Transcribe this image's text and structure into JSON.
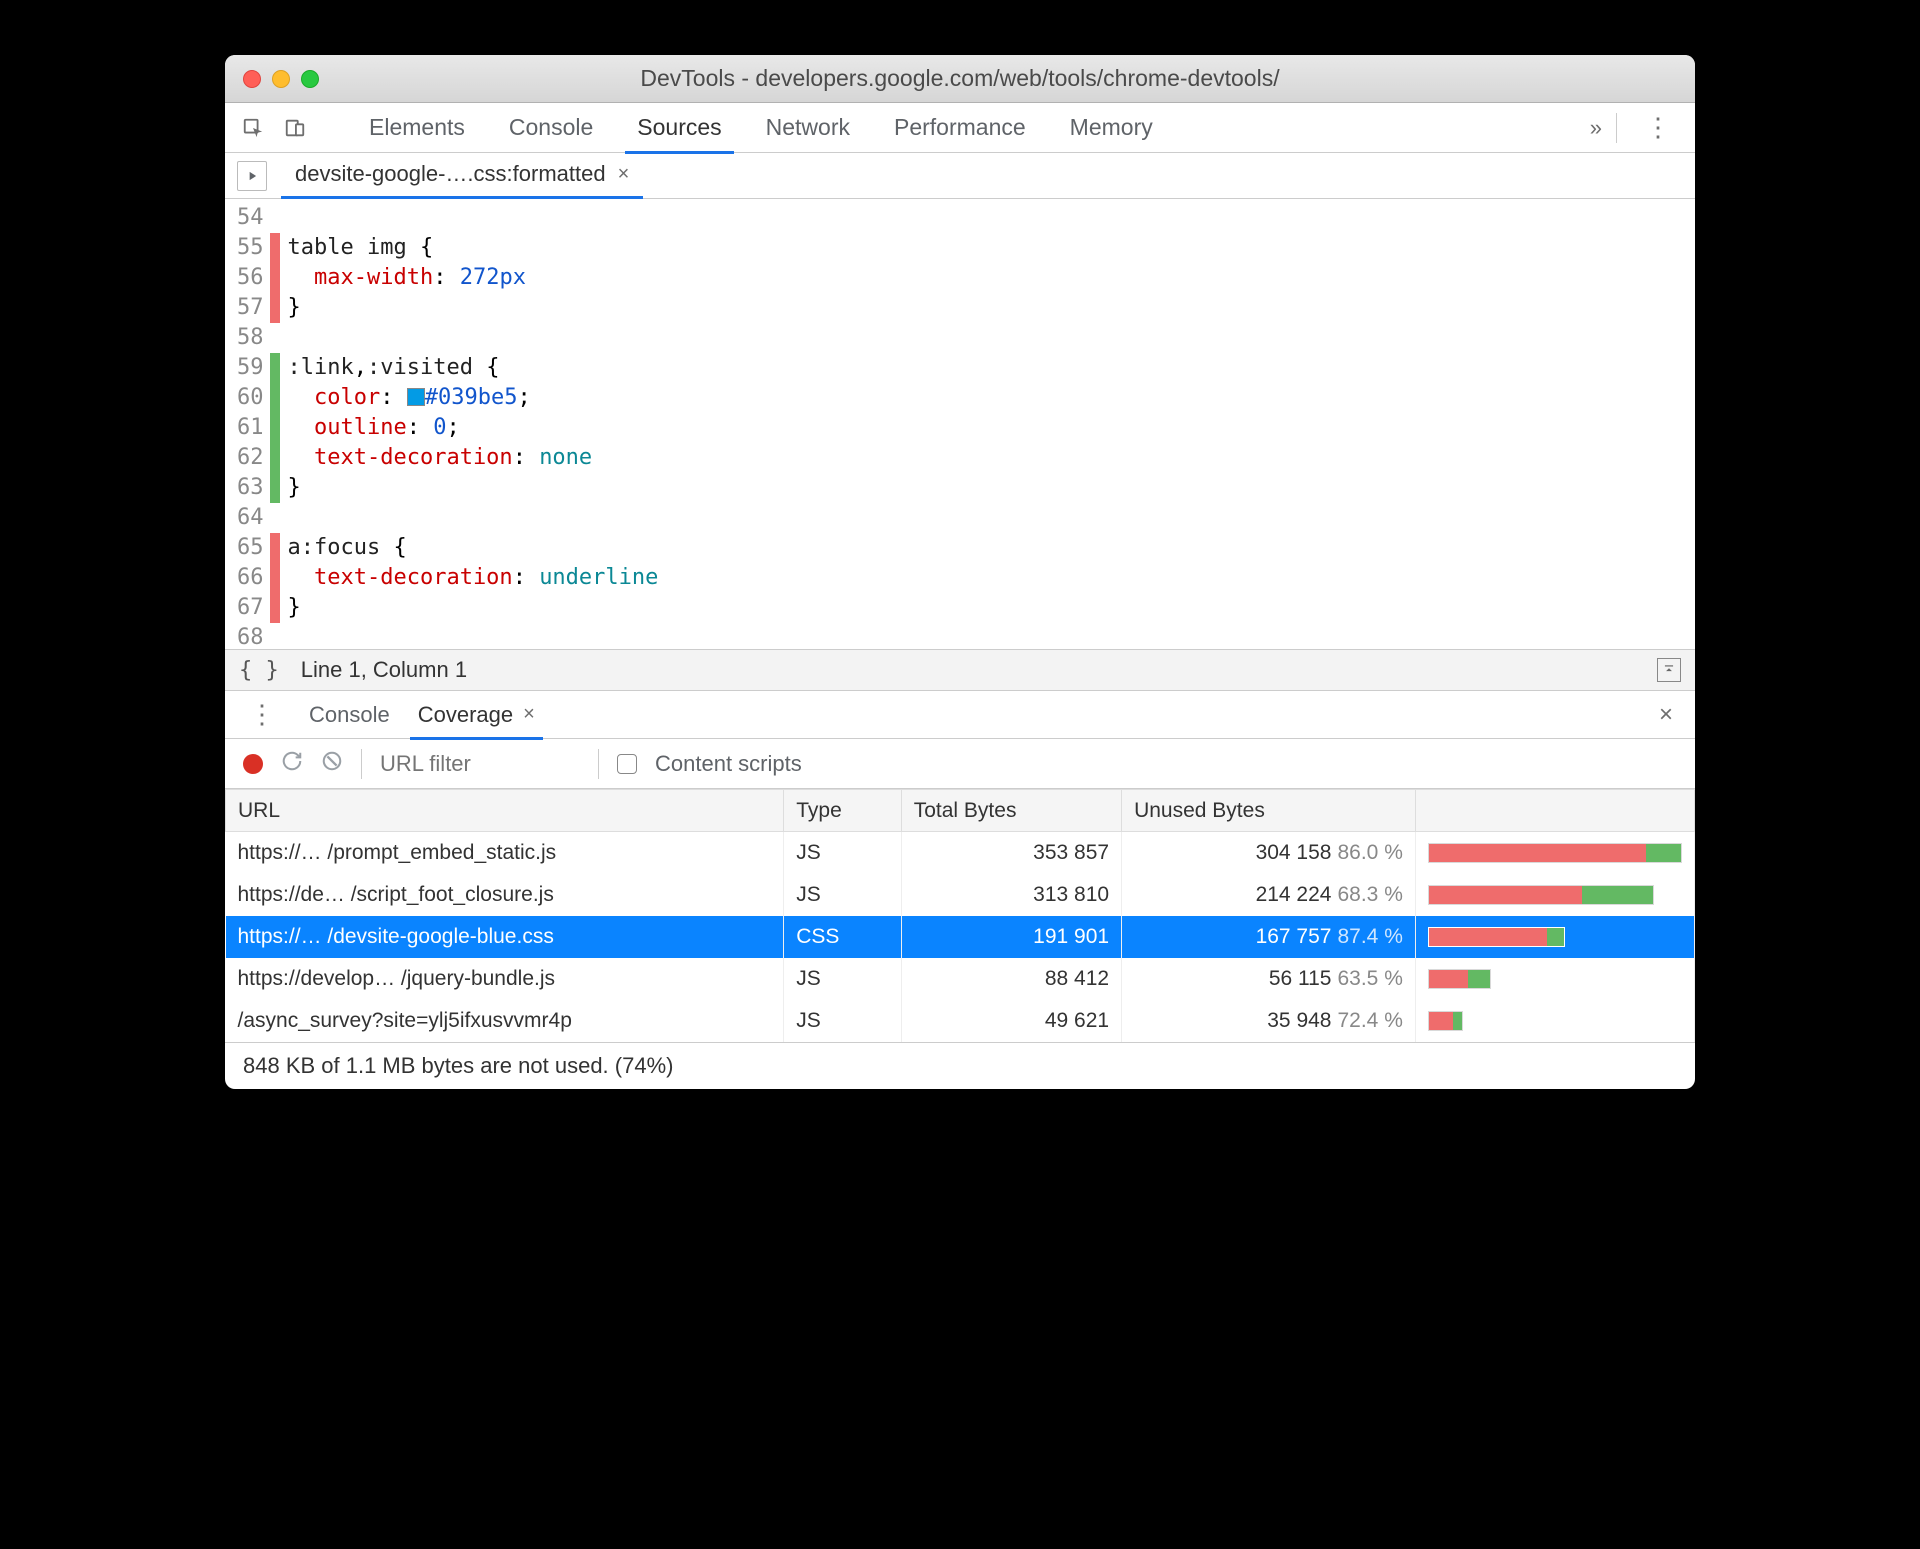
{
  "window": {
    "title": "DevTools - developers.google.com/web/tools/chrome-devtools/"
  },
  "toolbar": {
    "tabs": [
      "Elements",
      "Console",
      "Sources",
      "Network",
      "Performance",
      "Memory"
    ],
    "active_tab": "Sources"
  },
  "filetab": {
    "name": "devsite-google-….css:formatted"
  },
  "editor": {
    "lines": [
      {
        "n": 54,
        "cov": "",
        "html": ""
      },
      {
        "n": 55,
        "cov": "red",
        "html": "<span class='sel'>table img</span> {"
      },
      {
        "n": 56,
        "cov": "red",
        "html": "  <span class='prop'>max-width</span>: <span class='num'>272px</span>"
      },
      {
        "n": 57,
        "cov": "red",
        "html": "}"
      },
      {
        "n": 58,
        "cov": "",
        "html": ""
      },
      {
        "n": 59,
        "cov": "green",
        "html": "<span class='sel'>:link</span>,<span class='sel'>:visited</span> {"
      },
      {
        "n": 60,
        "cov": "green",
        "html": "  <span class='prop'>color</span>: <span class='swatch' style='background:#039be5'></span><span class='val'>#039be5</span>;"
      },
      {
        "n": 61,
        "cov": "green",
        "html": "  <span class='prop'>outline</span>: <span class='num'>0</span>;"
      },
      {
        "n": 62,
        "cov": "green",
        "html": "  <span class='prop'>text-decoration</span>: <span class='kw'>none</span>"
      },
      {
        "n": 63,
        "cov": "green",
        "html": "}"
      },
      {
        "n": 64,
        "cov": "",
        "html": ""
      },
      {
        "n": 65,
        "cov": "red",
        "html": "<span class='sel'>a:focus</span> {"
      },
      {
        "n": 66,
        "cov": "red",
        "html": "  <span class='prop'>text-decoration</span>: <span class='kw'>underline</span>"
      },
      {
        "n": 67,
        "cov": "red",
        "html": "}"
      },
      {
        "n": 68,
        "cov": "",
        "html": ""
      }
    ]
  },
  "status": {
    "cursor": "Line 1, Column 1"
  },
  "drawer": {
    "tabs": [
      "Console",
      "Coverage"
    ],
    "active_tab": "Coverage",
    "url_filter_placeholder": "URL filter",
    "content_scripts_label": "Content scripts"
  },
  "coverage": {
    "headers": [
      "URL",
      "Type",
      "Total Bytes",
      "Unused Bytes",
      ""
    ],
    "rows": [
      {
        "url": "https://… /prompt_embed_static.js",
        "type": "JS",
        "total": "353 857",
        "unused": "304 158",
        "pct": "86.0 %",
        "bar_pct": 86.0,
        "bar_scale": 1.0,
        "selected": false
      },
      {
        "url": "https://de… /script_foot_closure.js",
        "type": "JS",
        "total": "313 810",
        "unused": "214 224",
        "pct": "68.3 %",
        "bar_pct": 68.3,
        "bar_scale": 0.89,
        "selected": false
      },
      {
        "url": "https://… /devsite-google-blue.css",
        "type": "CSS",
        "total": "191 901",
        "unused": "167 757",
        "pct": "87.4 %",
        "bar_pct": 87.4,
        "bar_scale": 0.54,
        "selected": true
      },
      {
        "url": "https://develop… /jquery-bundle.js",
        "type": "JS",
        "total": "88 412",
        "unused": "56 115",
        "pct": "63.5 %",
        "bar_pct": 63.5,
        "bar_scale": 0.25,
        "selected": false
      },
      {
        "url": "/async_survey?site=ylj5ifxusvvmr4p",
        "type": "JS",
        "total": "49 621",
        "unused": "35 948",
        "pct": "72.4 %",
        "bar_pct": 72.4,
        "bar_scale": 0.14,
        "selected": false
      }
    ],
    "footer": "848 KB of 1.1 MB bytes are not used. (74%)"
  }
}
